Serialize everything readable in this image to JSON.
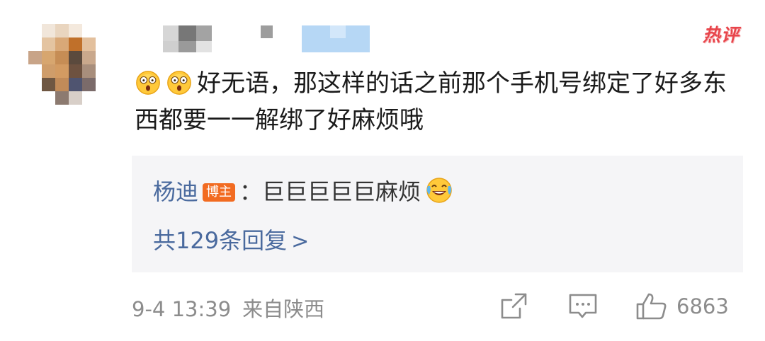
{
  "post": {
    "hot_tag": "热评",
    "comment_text": "好无语，那这样的话之前那个手机号绑定了好多东西都要一一解绑了好麻烦哦",
    "emoji_icon": "shocked-face-emoji"
  },
  "reply": {
    "author": "杨迪",
    "author_badge": "博主",
    "separator": "：",
    "text": "巨巨巨巨巨麻烦",
    "emoji_icon": "laughing-crying-emoji",
    "more_label": "共129条回复",
    "more_chevron": ">"
  },
  "footer": {
    "date": "9-4 13:39",
    "location": "来自陕西",
    "like_count": "6863"
  },
  "colors": {
    "link_blue": "#4a6a9e",
    "hot_red": "#e8454b",
    "badge_orange": "#f26b21",
    "gray_text": "#8c8c8c",
    "reply_bg": "#f5f5f7"
  }
}
